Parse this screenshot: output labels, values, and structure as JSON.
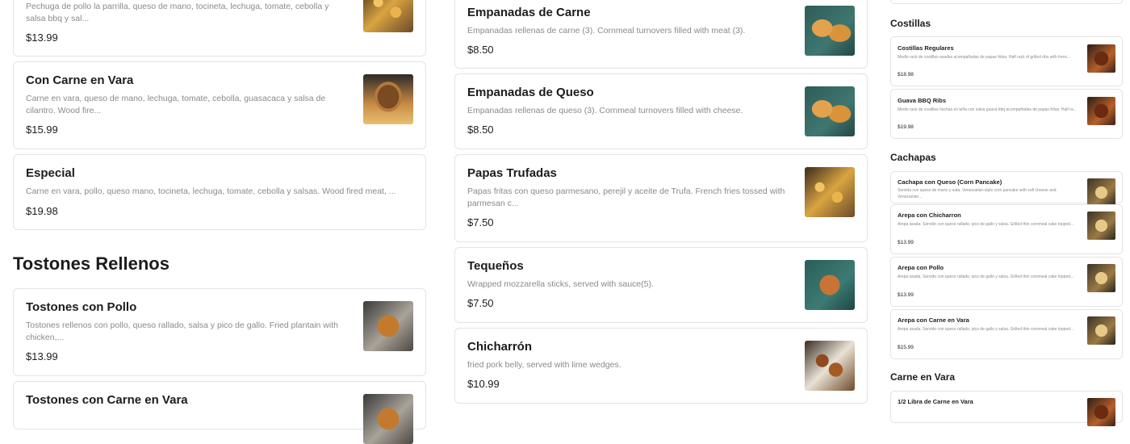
{
  "col1": {
    "items": [
      {
        "title": "",
        "desc": "Pechuga de pollo la parrilla, queso de mano, tocineta, lechuga, tomate, cebolla y salsa bbq y sal...",
        "price": "$13.99",
        "img": "fries-icon"
      },
      {
        "title": "Con Carne en Vara",
        "desc": "Carne en vara, queso de mano, lechuga, tomate, cebolla, guasacaca y salsa de cilantro. Wood fire...",
        "price": "$15.99",
        "img": "burger-icon"
      },
      {
        "title": "Especial",
        "desc": "Carne en vara, pollo, queso mano, tocineta, lechuga, tomate, cebolla y salsas. Wood fired meat, ...",
        "price": "$19.98",
        "img": ""
      }
    ],
    "section": "Tostones Rellenos",
    "tostones": [
      {
        "title": "Tostones con Pollo",
        "desc": "Tostones rellenos con pollo, queso rallado, salsa y pico de gallo. Fried plantain with chicken,...",
        "price": "$13.99",
        "img": "tostones-icon"
      },
      {
        "title": "Tostones con Carne en Vara",
        "desc": "",
        "price": "",
        "img": "tostones-icon"
      }
    ]
  },
  "col2": {
    "items": [
      {
        "title": "Empanadas de Carne",
        "desc": "Empanadas rellenas de carne (3). Cornmeal turnovers filled with meat (3).",
        "price": "$8.50",
        "img": "empanada-icon"
      },
      {
        "title": "Empanadas de Queso",
        "desc": "Empanadas rellenas de queso (3). Cornmeal turnovers filled with cheese.",
        "price": "$8.50",
        "img": "empanada-icon"
      },
      {
        "title": "Papas Trufadas",
        "desc": "Papas fritas con queso parmesano, perejil y aceite de Trufa. French fries tossed with parmesan c...",
        "price": "$7.50",
        "img": "fries-icon"
      },
      {
        "title": "Tequeños",
        "desc": "Wrapped mozzarella sticks, served with sauce(5).",
        "price": "$7.50",
        "img": "tequenos-icon"
      },
      {
        "title": "Chicharrón",
        "desc": "fried pork belly, served with lime wedges.",
        "price": "$10.99",
        "img": "chicharron-icon"
      }
    ]
  },
  "col3": {
    "costillas_title": "Costillas",
    "costillas": [
      {
        "title": "Costillas Regulares",
        "desc": "Medio rack de costillas asadas acompañadas de papas fritas. Half rack of grilled ribs with frenc...",
        "price": "$18.98"
      },
      {
        "title": "Guava BBQ Ribs",
        "desc": "Medio rack de costillas hechas en leña con salsa guava bbq acompañadas de papas fritas. Half ra...",
        "price": "$19.98"
      }
    ],
    "cachapas_title": "Cachapas",
    "cachapas": [
      {
        "title": "Cachapa con Queso (Corn Pancake)",
        "desc": "Servida con queso de mano y nata. Venezuelan-style corn pancake with soft cheese and Venezuelan...",
        "price": ""
      },
      {
        "title": "Arepa con Chicharron",
        "desc": "Arepa asada. Servido con queso rallado, pico de gallo y salsa. Grilled thin cornmeal cake topped...",
        "price": "$13.99"
      },
      {
        "title": "Arepa con Pollo",
        "desc": "Arepa asada. Servido con queso rallado, pico de gallo y salsa. Grilled thin cornmeal cake topped...",
        "price": "$13.99"
      },
      {
        "title": "Arepa con Carne en Vara",
        "desc": "Arepa asada. Servido con queso rallado, pico de gallo y salsa. Grilled thin cornmeal cake topped...",
        "price": "$15.99"
      }
    ],
    "carne_title": "Carne en Vara",
    "carne": [
      {
        "title": "1/2 Libra de Carne en Vara"
      }
    ]
  }
}
